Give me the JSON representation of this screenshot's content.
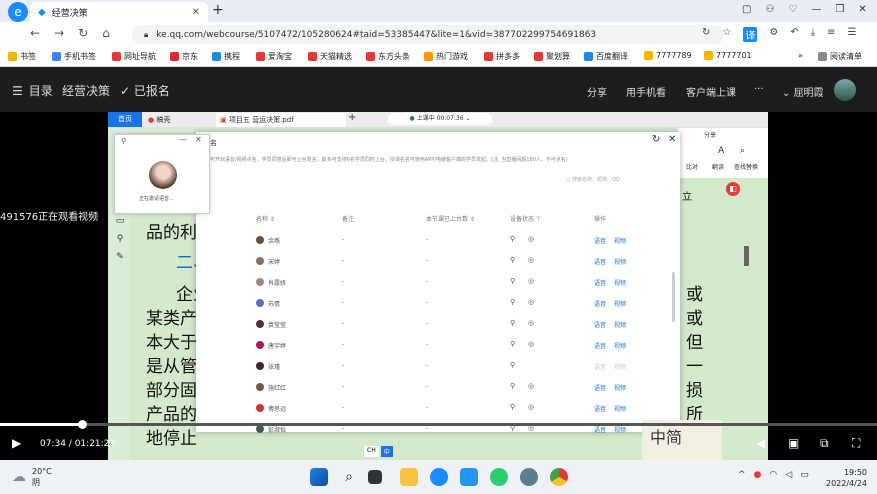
{
  "browser": {
    "tab_title": "经营决策",
    "url": "ke.qq.com/webcourse/5107472/105280624#taid=53385447&lite=1&vid=387702299754691863",
    "bookmarks": [
      "书签",
      "手机书签",
      "网址导航",
      "京东",
      "携程",
      "爱淘宝",
      "天猫精选",
      "东方头条",
      "热门游戏",
      "拼多多",
      "聚划算",
      "百度翻译",
      "7777789",
      "7777701"
    ],
    "reading_list": "阅读清单",
    "more": "»"
  },
  "site": {
    "menu": "目录",
    "course_title": "经营决策",
    "enrolled": "已报名",
    "share": "分享",
    "mobile": "用手机看",
    "client": "客户端上课",
    "more": "···",
    "user": "屈明霞"
  },
  "video": {
    "watermark": "491576正在观看视频",
    "app_tabs": {
      "home": "首页",
      "draft": "稿壳",
      "file": "项目五 营运决策.pdf",
      "status": "上课中 00:07:36"
    },
    "invite": {
      "text": "正在邀请语音..."
    },
    "panel": {
      "letter": "名",
      "notice": "可开启语音/视频点名，学员同意后即可上台发言，最多可支持6名学员同时上台。授课名名可使用APP/电脑客户端的学员发起。(注: 当直播间超180人，不可点名)",
      "search_placeholder": "搜索名称、昵称、QQ",
      "columns": [
        "名称",
        "备注",
        "本节课已上台数",
        "设备状态",
        "操作"
      ],
      "students": [
        {
          "name": "余燕",
          "actions": [
            "语音",
            "视频"
          ]
        },
        {
          "name": "宋婷",
          "actions": [
            "语音",
            "视频"
          ]
        },
        {
          "name": "肖露妍",
          "actions": [
            "语音",
            "视频"
          ]
        },
        {
          "name": "苏倩",
          "actions": [
            "语音",
            "视频"
          ]
        },
        {
          "name": "袁莹莹",
          "actions": [
            "语音",
            "视频"
          ]
        },
        {
          "name": "唐宇婷",
          "actions": [
            "语音",
            "视频"
          ]
        },
        {
          "name": "张瑾",
          "actions": [
            "语音",
            "视频"
          ]
        },
        {
          "name": "施红红",
          "actions": [
            "语音",
            "视频"
          ]
        },
        {
          "name": "傅思远",
          "actions": [
            "语音",
            "视频"
          ]
        },
        {
          "name": "彭淑怡",
          "actions": [
            "语音",
            "视频"
          ]
        }
      ],
      "dash": "-"
    },
    "side_tools": [
      "比对",
      "翻读",
      "查找替换"
    ],
    "side_top": "分享",
    "side_letter": "立",
    "doc_lines": [
      "品的利润",
      "二、",
      "企业",
      "某类产品",
      "本大于收",
      "是从管理",
      "部分固定",
      "产品的销",
      "地停止"
    ],
    "doc_right": [
      "或",
      "或",
      "但",
      "一",
      "损",
      "所"
    ],
    "ime": "CH",
    "ime_mode": "中",
    "stamp": "中简"
  },
  "player": {
    "current": "07:34",
    "total": "01:21:23",
    "progress": 0.093
  },
  "taskbar": {
    "temp": "20°C",
    "weather": "阴",
    "time": "19:50",
    "date": "2022/4/24"
  }
}
